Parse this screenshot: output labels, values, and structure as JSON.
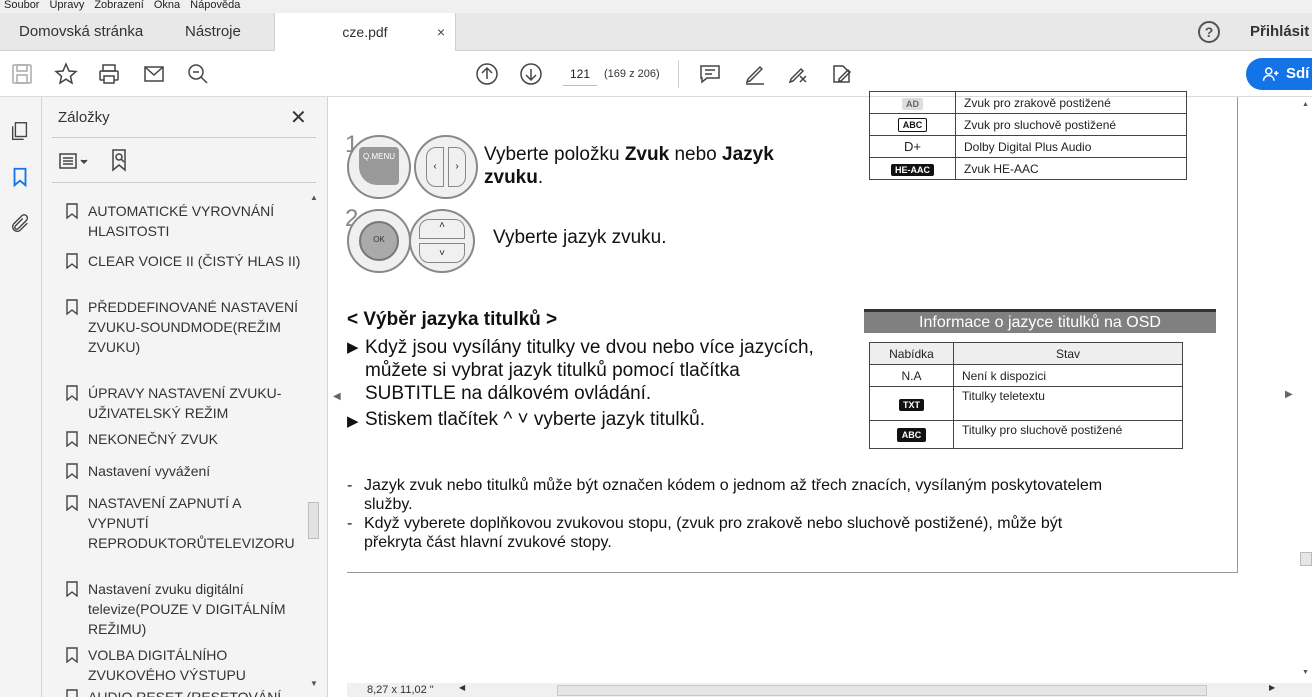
{
  "menubar": {
    "items": [
      "Soubor",
      "Úpravy",
      "Zobrazení",
      "Okna",
      "Nápověda"
    ]
  },
  "tabs": {
    "home": "Domovská stránka",
    "tools": "Nástroje",
    "document": "cze.pdf",
    "close": "×"
  },
  "header": {
    "help": "?",
    "signin": "Přihlásit"
  },
  "toolbar": {
    "page_current": "121",
    "page_count": "(169 z 206)",
    "share_label": "Sdí"
  },
  "panel": {
    "title": "Záložky",
    "close": "✕",
    "bookmarks": [
      "AUTOMATICKÉ VYROVNÁNÍ HLASITOSTI",
      "CLEAR VOICE II (ČISTÝ HLAS II)",
      "PŘEDDEFINOVANÉ NASTAVENÍ ZVUKU-SOUNDMODE(REŽIM ZVUKU)",
      "ÚPRAVY NASTAVENÍ ZVUKU-UŽIVATELSKÝ REŽIM",
      "NEKONEČNÝ ZVUK",
      "Nastavení vyvážení",
      "NASTAVENÍ ZAPNUTÍ A VYPNUTÍ REPRODUKTORŮTELEVIZORU",
      "Nastavení zvuku digitální televize(POUZE V DIGITÁLNÍM REŽIMU)",
      "VOLBA DIGITÁLNÍHO ZVUKOVÉHO VÝSTUPU",
      "AUDIO RESET (RESETOVÁNÍ"
    ]
  },
  "document": {
    "step1_num": "1",
    "step2_num": "2",
    "qmenu_label": "Q.MENU",
    "ok_label": "OK",
    "step1_text_a": "Vyberte položku ",
    "step1_bold_a": "Zvuk",
    "step1_text_b": " nebo ",
    "step1_bold_b": "Jazyk",
    "step1_bold_c": "zvuku",
    "step1_text_c": ".",
    "step2_text": "Vyberte jazyk zvuku.",
    "top_table": {
      "rows": [
        {
          "icon": "AD",
          "label": "Zvuk pro zrakově postižené"
        },
        {
          "icon": "ABC",
          "label": "Zvuk pro sluchově postižené"
        },
        {
          "icon": "D+",
          "label": "Dolby Digital Plus Audio"
        },
        {
          "icon": "HE-AAC",
          "label": "Zvuk HE-AAC"
        }
      ]
    },
    "subtitle_heading": "< Výběr jazyka titulků >",
    "bullet1_lines": [
      "Když jsou vysílány titulky ve dvou nebo více jazycích,",
      "můžete si vybrat jazyk titulků pomocí tlačítka",
      "SUBTITLE na dálkovém ovládání."
    ],
    "bullet2_a": "Stiskem tlačítek ",
    "bullet2_keys": "^ ˅",
    "bullet2_b": " vyberte jazyk titulků.",
    "osd": {
      "title": "Informace o jazyce titulků na OSD",
      "col1": "Nabídka",
      "col2": "Stav",
      "rows": [
        {
          "menu": "N.A",
          "state": "Není k  dispozici"
        },
        {
          "menu": "TXT",
          "state": "Titulky teletextu"
        },
        {
          "menu": "ABC",
          "state": "Titulky pro sluchově postižené"
        }
      ]
    },
    "notes": [
      [
        "Jazyk zvuk nebo titulků může být označen kódem o jednom až třech znacích, vysílaným poskytovatelem",
        "služby."
      ],
      [
        "Když vyberete doplňkovou zvukovou stopu, (zvuk pro zrakově nebo sluchově postižené), může být",
        "překryta část hlavní zvukové stopy."
      ]
    ]
  },
  "status": {
    "page_size": "8,27 x 11,02 \""
  },
  "colors": {
    "accent": "#1473e6",
    "osd_header": "#808080"
  }
}
